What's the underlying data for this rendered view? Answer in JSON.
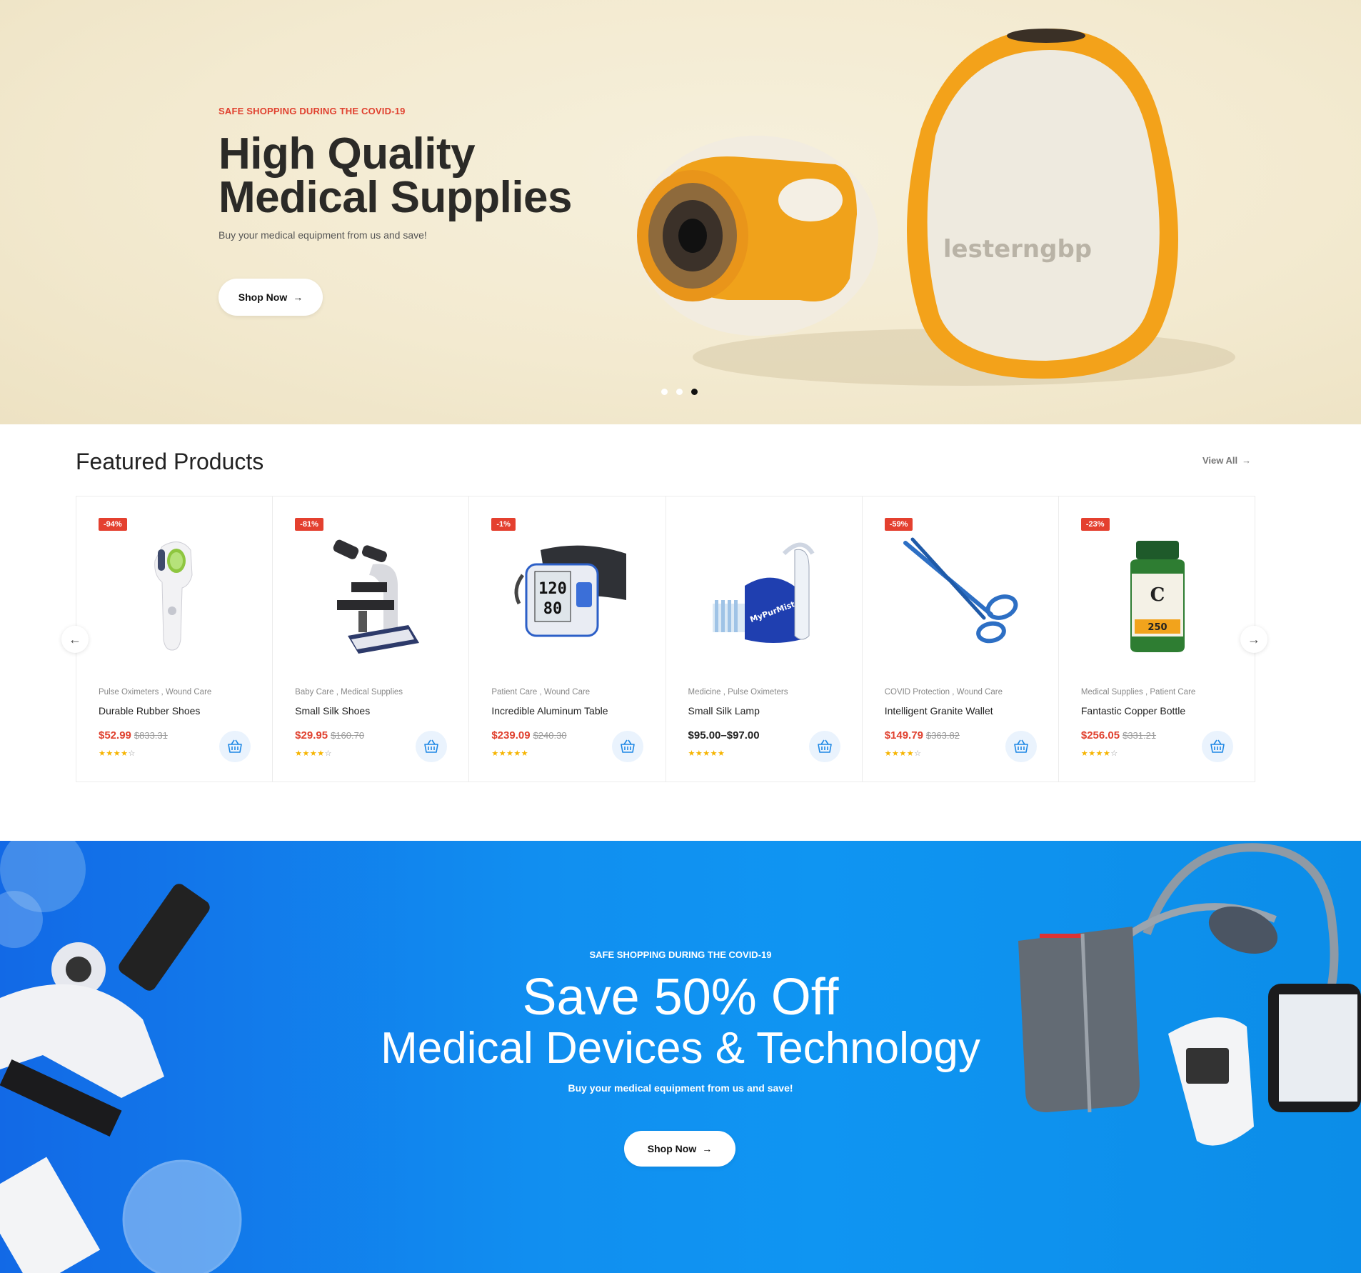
{
  "hero": {
    "eyebrow": "SAFE SHOPPING DURING THE COVID-19",
    "title_line1": "High Quality",
    "title_line2": "Medical Supplies",
    "subtitle": "Buy your medical equipment from us and save!",
    "button_label": "Shop Now",
    "watermark": "lesterngbp",
    "slides": 3,
    "active_slide": 3
  },
  "featured": {
    "title": "Featured Products",
    "view_all": "View All",
    "products": [
      {
        "badge": "-94%",
        "categories": "Pulse Oximeters , Wound Care",
        "name": "Durable Rubber Shoes",
        "price": "$52.99",
        "old_price": "$833.31",
        "rating": 4.5,
        "stars_full": "★★★★",
        "stars_empty": "☆",
        "icon": "thermometer-image"
      },
      {
        "badge": "-81%",
        "categories": "Baby Care , Medical Supplies",
        "name": "Small Silk Shoes",
        "price": "$29.95",
        "old_price": "$160.70",
        "rating": 4,
        "stars_full": "★★★★",
        "stars_empty": "☆",
        "icon": "microscope-image"
      },
      {
        "badge": "-1%",
        "categories": "Patient Care , Wound Care",
        "name": "Incredible Aluminum Table",
        "price": "$239.09",
        "old_price": "$240.30",
        "rating": 5,
        "stars_full": "★★★★★",
        "stars_empty": "",
        "icon": "blood-pressure-monitor-image",
        "monitor_top": "120",
        "monitor_bottom": "80"
      },
      {
        "badge": "",
        "categories": "Medicine , Pulse Oximeters",
        "name": "Small Silk Lamp",
        "price": "$95.00–$97.00",
        "old_price": "",
        "rating": 5,
        "stars_full": "★★★★★",
        "stars_empty": "",
        "icon": "nebulizer-kit-image",
        "brand": "MyPurMist"
      },
      {
        "badge": "-59%",
        "categories": "COVID Protection , Wound Care",
        "name": "Intelligent Granite Wallet",
        "price": "$149.79",
        "old_price": "$363.82",
        "rating": 4,
        "stars_full": "★★★★",
        "stars_empty": "☆",
        "icon": "scissors-image"
      },
      {
        "badge": "-23%",
        "categories": "Medical Supplies , Patient Care",
        "name": "Fantastic Copper Bottle",
        "price": "$256.05",
        "old_price": "$331.21",
        "rating": 4,
        "stars_full": "★★★★",
        "stars_empty": "☆",
        "icon": "vitamin-bottle-image",
        "label_letter": "C",
        "label_number": "250"
      }
    ]
  },
  "promo": {
    "eyebrow": "SAFE SHOPPING DURING THE COVID-19",
    "title_line1": "Save 50% Off",
    "title_line2": "Medical Devices & Technology",
    "subtitle": "Buy your medical equipment from us and save!",
    "button_label": "Shop Now"
  },
  "colors": {
    "accent_red": "#e0412f",
    "promo_blue": "#118ff0",
    "star": "#f6b400"
  }
}
